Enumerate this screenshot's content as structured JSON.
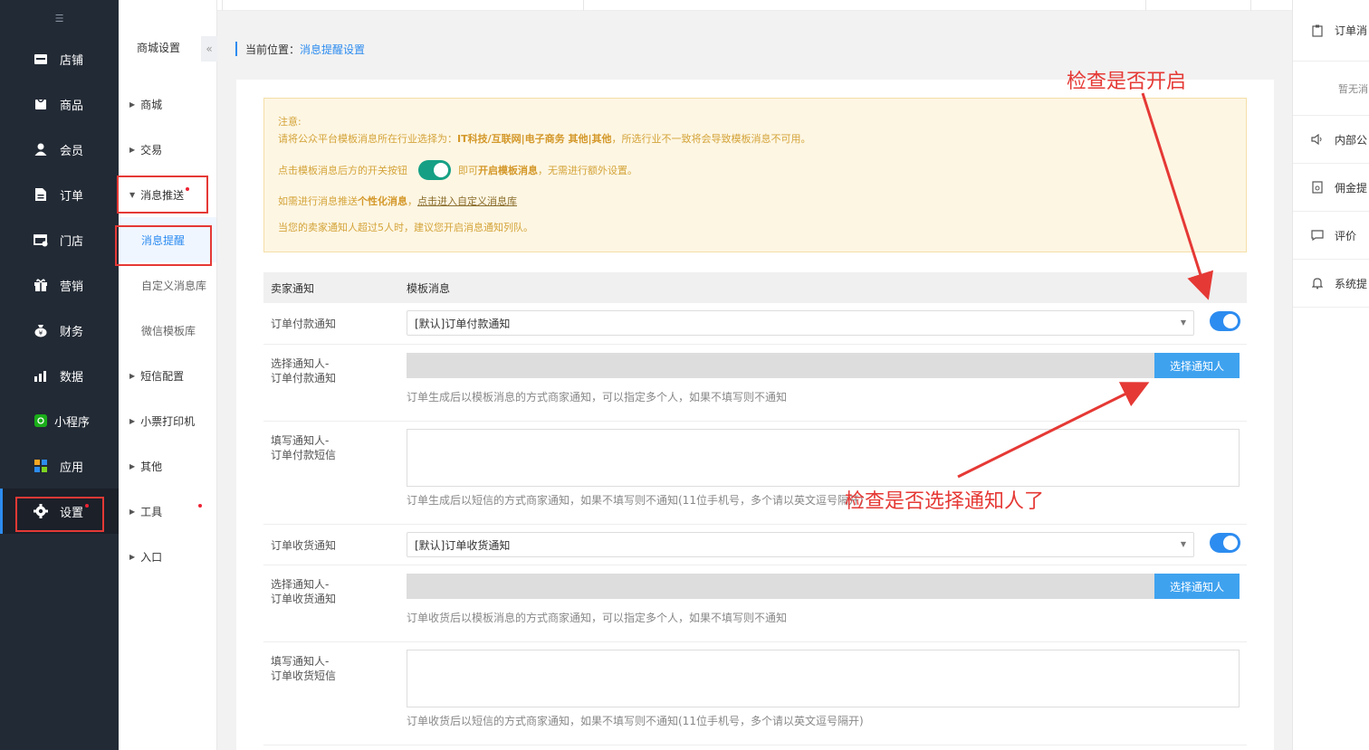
{
  "sidebar": {
    "collapse_icon": "hamburger-icon",
    "items": [
      {
        "label": "店铺",
        "icon": "shop-icon"
      },
      {
        "label": "商品",
        "icon": "goods-icon"
      },
      {
        "label": "会员",
        "icon": "user-icon"
      },
      {
        "label": "订单",
        "icon": "document-icon"
      },
      {
        "label": "门店",
        "icon": "store-icon"
      },
      {
        "label": "营销",
        "icon": "gift-icon"
      },
      {
        "label": "财务",
        "icon": "money-bag-icon"
      },
      {
        "label": "数据",
        "icon": "bar-chart-icon"
      },
      {
        "label": "小程序",
        "icon": "mini-program-icon"
      },
      {
        "label": "应用",
        "icon": "apps-icon"
      },
      {
        "label": "设置",
        "icon": "gear-icon",
        "active": true
      }
    ]
  },
  "subnav": {
    "title": "商城设置",
    "items": [
      {
        "label": "商城"
      },
      {
        "label": "交易"
      },
      {
        "label": "消息推送",
        "expanded": true
      },
      {
        "label": "消息提醒",
        "sub": true,
        "active": true
      },
      {
        "label": "自定义消息库",
        "sub": true
      },
      {
        "label": "微信模板库",
        "sub": true
      },
      {
        "label": "短信配置"
      },
      {
        "label": "小票打印机"
      },
      {
        "label": "其他"
      },
      {
        "label": "工具"
      },
      {
        "label": "入口"
      }
    ]
  },
  "breadcrumb": {
    "prefix": "当前位置：",
    "current": "消息提醒设置"
  },
  "notice": {
    "title": "注意:",
    "line1_prefix": "请将公众平台模板消息所在行业选择为：",
    "line1_bold": "IT科技/互联网|电子商务 其他|其他",
    "line1_suffix": "，所选行业不一致将会导致模板消息不可用。",
    "line2_prefix": "点击模板消息后方的开关按钮",
    "line2_middle": "即可",
    "line2_bold": "开启模板消息",
    "line2_suffix": "，无需进行额外设置。",
    "line3_prefix": "如需进行消息推送",
    "line3_bold": "个性化消息",
    "line3_sep": "，",
    "line3_link": "点击进入自定义消息库",
    "line4": "当您的卖家通知人超过5人时，建议您开启消息通知列队。"
  },
  "table": {
    "col1": "卖家通知",
    "col2": "模板消息",
    "pay": {
      "label": "订单付款通知",
      "select_value": "[默认]订单付款通知",
      "picker_label_1": "选择通知人-",
      "picker_label_2": "订单付款通知",
      "picker_button": "选择通知人",
      "picker_hint": "订单生成后以模板消息的方式商家通知，可以指定多个人，如果不填写则不通知",
      "sms_label_1": "填写通知人-",
      "sms_label_2": "订单付款短信",
      "sms_hint": "订单生成后以短信的方式商家通知，如果不填写则不通知(11位手机号，多个请以英文逗号隔开)"
    },
    "receive": {
      "label": "订单收货通知",
      "select_value": "[默认]订单收货通知",
      "picker_label_1": "选择通知人-",
      "picker_label_2": "订单收货通知",
      "picker_button": "选择通知人",
      "picker_hint": "订单收货后以模板消息的方式商家通知，可以指定多个人，如果不填写则不通知",
      "sms_label_1": "填写通知人-",
      "sms_label_2": "订单收货短信",
      "sms_hint": "订单收货后以短信的方式商家通知，如果不填写则不通知(11位手机号，多个请以英文逗号隔开)"
    }
  },
  "right_panel": {
    "items": [
      {
        "label": "订单消",
        "icon": "clipboard-icon"
      },
      {
        "label": "暂无消",
        "empty": true
      },
      {
        "label": "内部公",
        "icon": "speaker-icon"
      },
      {
        "label": "佣金提",
        "icon": "commission-icon"
      },
      {
        "label": "评价",
        "icon": "comment-icon"
      },
      {
        "label": "系统提",
        "icon": "bell-icon"
      }
    ]
  },
  "annotations": {
    "toggle_check": "检查是否开启",
    "recipient_check": "检查是否选择通知人了",
    "color": "#e53935"
  },
  "colors": {
    "sidebar_bg": "#222a35",
    "accent": "#2d8cf0",
    "notice_bg": "#fdf6e3",
    "notice_text": "#d4a43a",
    "toggle_green": "#15a085"
  }
}
